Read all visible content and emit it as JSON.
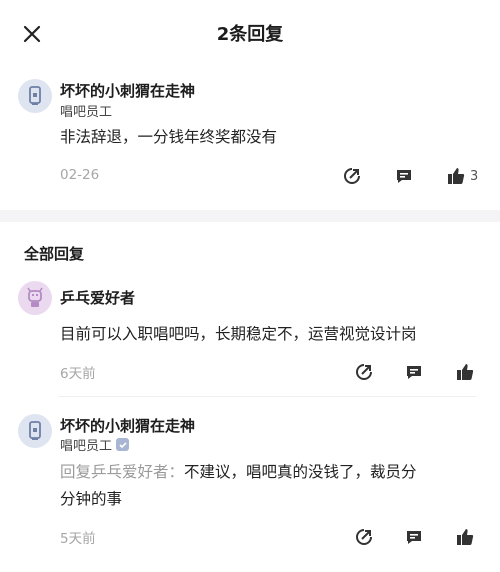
{
  "header": {
    "title": "2条回复"
  },
  "main_comment": {
    "user_name": "坏坏的小刺猬在走神",
    "user_title": "唱吧员工",
    "content": "非法辞退，一分钱年终奖都没有",
    "time": "02-26",
    "like_count": "3"
  },
  "section_title": "全部回复",
  "replies": [
    {
      "user_name": "乒乓爱好者",
      "user_title": "",
      "content": "目前可以入职唱吧吗，长期稳定不，运营视觉设计岗",
      "time": "6天前"
    },
    {
      "user_name": "坏坏的小刺猬在走神",
      "user_title": "唱吧员工",
      "reply_prefix": "回复乒乓爱好者：",
      "content_line1": "不建议，唱吧真的没钱了，裁员分",
      "content_line2": "分钟的事",
      "time": "5天前"
    }
  ],
  "icons": {
    "close": "close-icon",
    "share": "share-icon",
    "comment": "comment-icon",
    "like": "thumbs-up-icon",
    "verified": "verified-badge-icon"
  },
  "colors": {
    "band": "#f4f4f6",
    "muted": "#a6a6a6",
    "avatar_blue": "#dfe4f1",
    "avatar_purple": "#ead9ef"
  }
}
